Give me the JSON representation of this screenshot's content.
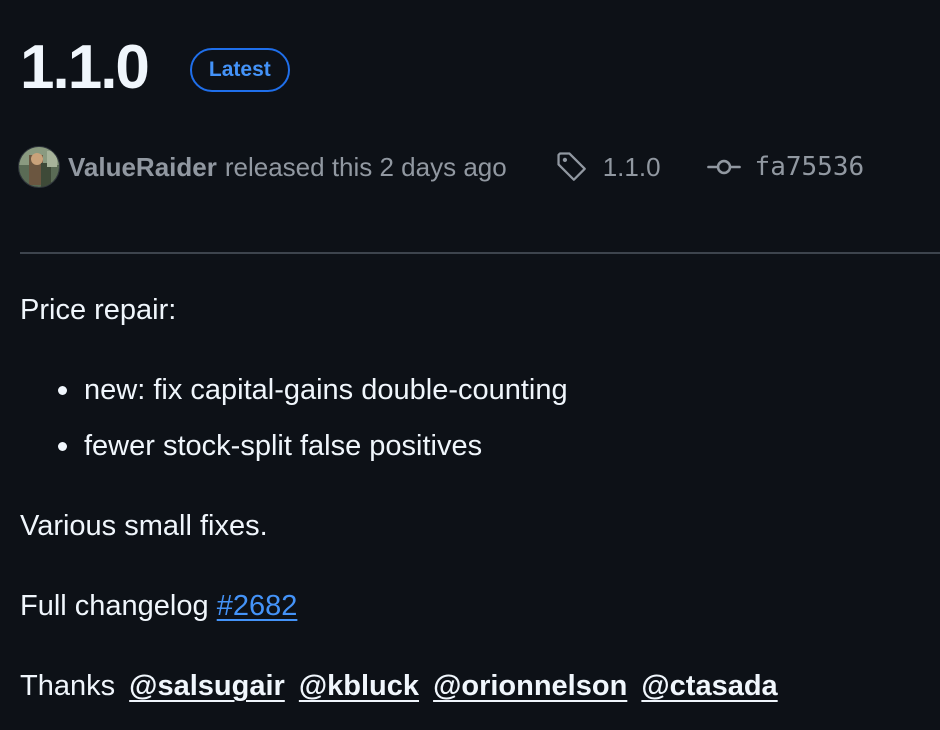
{
  "release": {
    "title": "1.1.0",
    "badge": "Latest"
  },
  "meta": {
    "author": "ValueRaider",
    "released_text": "released this 2 days ago",
    "tag": "1.1.0",
    "commit": "fa75536",
    "icons": {
      "avatar": "avatar",
      "tag": "tag-icon",
      "commit": "git-commit-icon"
    }
  },
  "notes": {
    "heading": "Price repair:",
    "items": [
      "new: fix capital-gains double-counting",
      "fewer stock-split false positives"
    ],
    "various": "Various small fixes.",
    "changelog_label": "Full changelog",
    "changelog_link": "#2682",
    "thanks_label": "Thanks",
    "mentions": [
      "@salsugair",
      "@kbluck",
      "@orionnelson",
      "@ctasada"
    ]
  },
  "colors": {
    "background": "#0d1117",
    "text": "#f0f6fc",
    "muted": "#9198a1",
    "link": "#4493f8",
    "badge_border": "#1f6feb"
  }
}
